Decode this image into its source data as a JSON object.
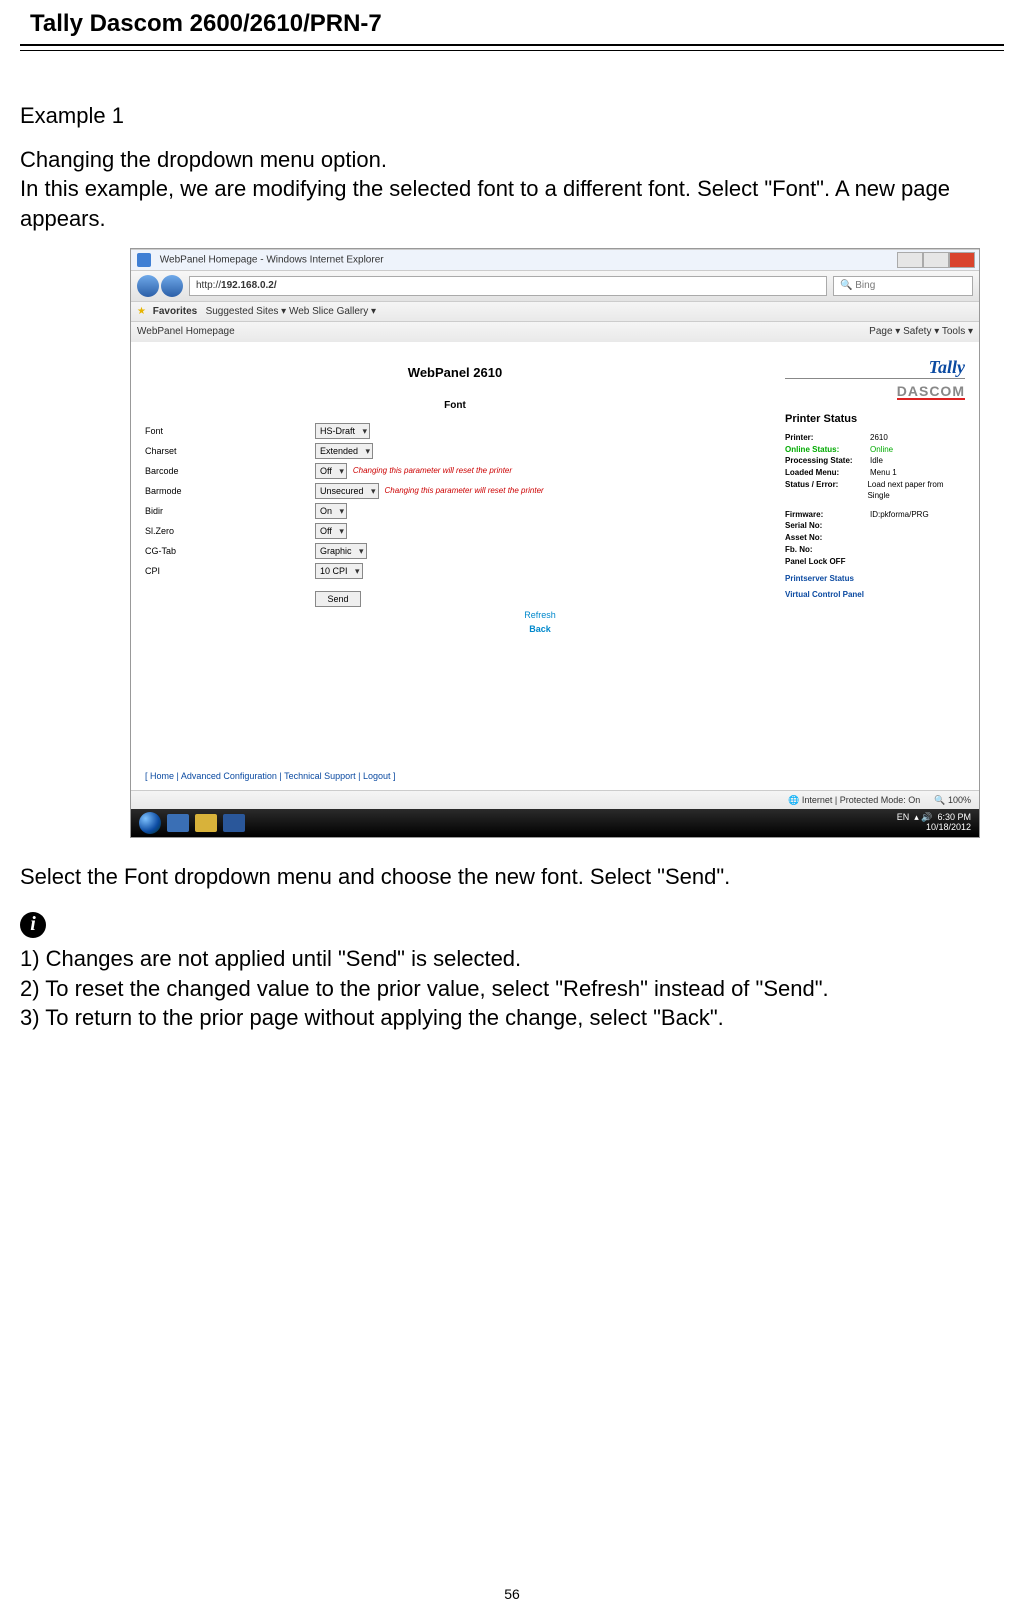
{
  "doc": {
    "title": "Tally Dascom 2600/2610/PRN-7",
    "example_label": "Example 1",
    "intro_line1": "Changing the dropdown menu option.",
    "intro_line2": "In this example, we are modifying the selected font to a different font. Select \"Font\". A new page appears.",
    "after_para": "Select the Font dropdown menu and choose the new font. Select \"Send\".",
    "note1": "1) Changes are not applied until \"Send\" is selected.",
    "note2": "2) To reset the changed value to the prior value, select \"Refresh\" instead of \"Send\".",
    "note3": "3) To return to the prior page without applying the change, select \"Back\".",
    "page_number": "56",
    "info_glyph": "i"
  },
  "ss": {
    "window_title": "WebPanel Homepage - Windows Internet Explorer",
    "address": "192.168.0.2/",
    "search_placeholder": "Bing",
    "favorites_label": "Favorites",
    "fav_links": "Suggested Sites ▾   Web Slice Gallery ▾",
    "tab_label": "WebPanel Homepage",
    "toolbar_right": "Page ▾   Safety ▾   Tools ▾",
    "panel_title": "WebPanel 2610",
    "section_title": "Font",
    "rows": [
      {
        "label": "Font",
        "value": "HS-Draft",
        "note": ""
      },
      {
        "label": "Charset",
        "value": "Extended",
        "note": ""
      },
      {
        "label": "Barcode",
        "value": "Off",
        "note": "Changing this parameter will reset the printer"
      },
      {
        "label": "Barmode",
        "value": "Unsecured",
        "note": "Changing this parameter will reset the printer"
      },
      {
        "label": "Bidir",
        "value": "On",
        "note": ""
      },
      {
        "label": "Sl.Zero",
        "value": "Off",
        "note": ""
      },
      {
        "label": "CG-Tab",
        "value": "Graphic",
        "note": ""
      },
      {
        "label": "CPI",
        "value": "10 CPI",
        "note": ""
      }
    ],
    "send_label": "Send",
    "refresh_label": "Refresh",
    "back_label": "Back",
    "logo_top": "Tally",
    "logo_bottom": "DASCOM",
    "status_title": "Printer Status",
    "status_rows": [
      {
        "k": "Printer:",
        "v": "2610"
      },
      {
        "k": "Online Status:",
        "v": "Online",
        "cls": "online"
      },
      {
        "k": "Processing State:",
        "v": "Idle"
      },
      {
        "k": "Loaded Menu:",
        "v": "Menu 1"
      },
      {
        "k": "Status / Error:",
        "v": "Load next paper from Single"
      },
      {
        "k": "Firmware:",
        "v": "ID:pkforma/PRG"
      },
      {
        "k": "Serial No:",
        "v": ""
      },
      {
        "k": "Asset No:",
        "v": ""
      },
      {
        "k": "Fb. No:",
        "v": ""
      },
      {
        "k": "Panel Lock OFF",
        "v": ""
      }
    ],
    "side_links": [
      "Printserver Status",
      "Virtual Control Panel"
    ],
    "footer_links": "[ Home | Advanced Configuration | Technical Support | Logout ]",
    "statusbar_internet": "Internet | Protected Mode: On",
    "statusbar_zoom": "100%",
    "taskbar_lang": "EN",
    "taskbar_time": "6:30 PM",
    "taskbar_date": "10/18/2012",
    "addr_prefix": "http://"
  }
}
